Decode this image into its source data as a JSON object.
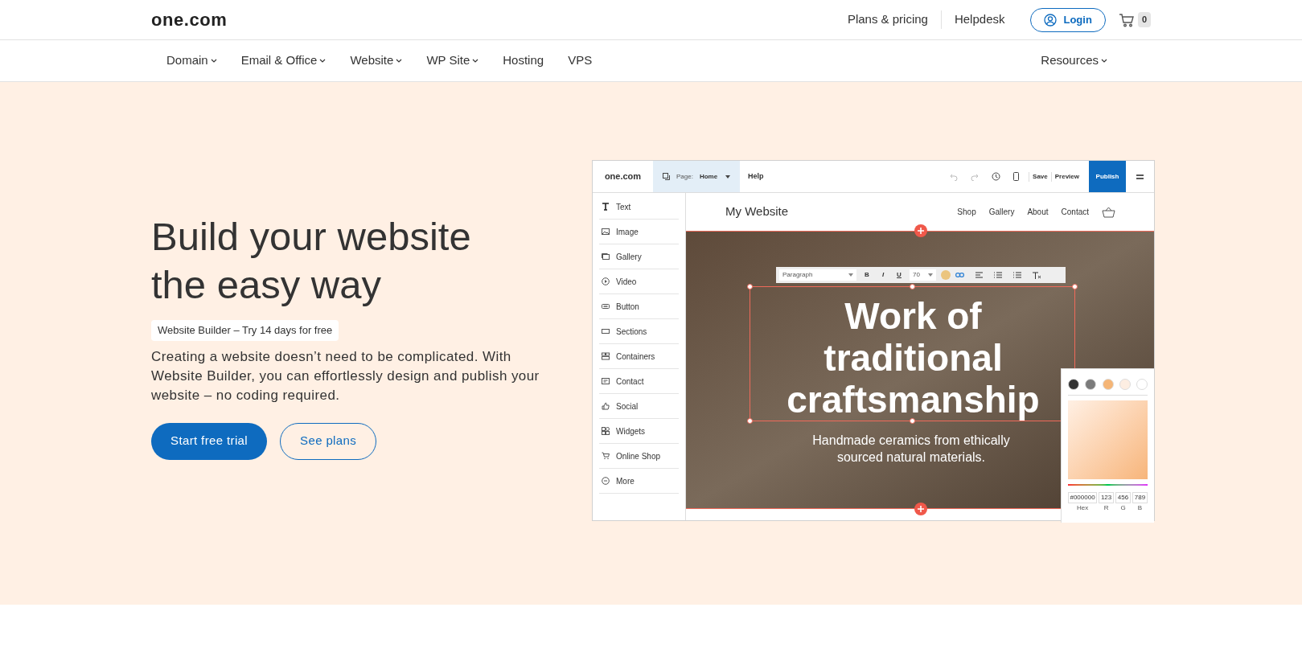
{
  "header": {
    "logo": "one.com",
    "links": [
      "Plans & pricing",
      "Helpdesk"
    ],
    "login": "Login",
    "cart_count": "0"
  },
  "nav": {
    "items": [
      {
        "label": "Domain",
        "dropdown": true
      },
      {
        "label": "Email & Office",
        "dropdown": true
      },
      {
        "label": "Website",
        "dropdown": true
      },
      {
        "label": "WP Site",
        "dropdown": true
      },
      {
        "label": "Hosting",
        "dropdown": false
      },
      {
        "label": "VPS",
        "dropdown": false
      }
    ],
    "right": {
      "label": "Resources",
      "dropdown": true
    }
  },
  "hero": {
    "title": "Build your website the easy way",
    "badge": "Website Builder – Try 14 days for free",
    "description": "Creating a website doesn’t need to be complicated. With Website Builder, you can effortlessly design and publish your website – no coding required.",
    "buttons": [
      {
        "label": "Start free trial",
        "kind": "primary"
      },
      {
        "label": "See plans",
        "kind": "outline"
      }
    ]
  },
  "builder": {
    "logo": "one.com",
    "page_label": "Page:",
    "page_value": "Home",
    "help": "Help",
    "actions": [
      "Save",
      "Preview"
    ],
    "publish": "Publish",
    "elements": [
      {
        "label": "Text",
        "kind": "text"
      },
      {
        "label": "Image",
        "kind": "image"
      },
      {
        "label": "Gallery",
        "kind": "gallery"
      },
      {
        "label": "Video",
        "kind": "video"
      },
      {
        "label": "Button",
        "kind": "button"
      },
      {
        "label": "Sections",
        "kind": "sections"
      },
      {
        "label": "Containers",
        "kind": "containers"
      },
      {
        "label": "Contact",
        "kind": "contact"
      },
      {
        "label": "Social",
        "kind": "social"
      },
      {
        "label": "Widgets",
        "kind": "widgets"
      },
      {
        "label": "Online Shop",
        "kind": "shop"
      },
      {
        "label": "More",
        "kind": "more"
      }
    ],
    "site": {
      "title": "My Website",
      "nav": [
        "Shop",
        "Gallery",
        "About",
        "Contact"
      ],
      "heading": "Work of traditional craftsmanship",
      "subheading": "Handmade ceramics from ethically sourced natural materials."
    },
    "toolbar": {
      "style": "Paragraph",
      "format_buttons": [
        "B",
        "I",
        "U"
      ],
      "size": "70",
      "color": "#ebc57f"
    },
    "picker": {
      "swatches": [
        {
          "color": "#333333"
        },
        {
          "color": "#7b7b7b"
        },
        {
          "color": "#f5b576"
        },
        {
          "color": "#fdeee2"
        },
        {
          "color": "#ffffff"
        }
      ],
      "fields": [
        {
          "value": "#000000",
          "label": "Hex"
        },
        {
          "value": "123",
          "label": "R"
        },
        {
          "value": "456",
          "label": "G"
        },
        {
          "value": "789",
          "label": "B"
        }
      ]
    }
  }
}
